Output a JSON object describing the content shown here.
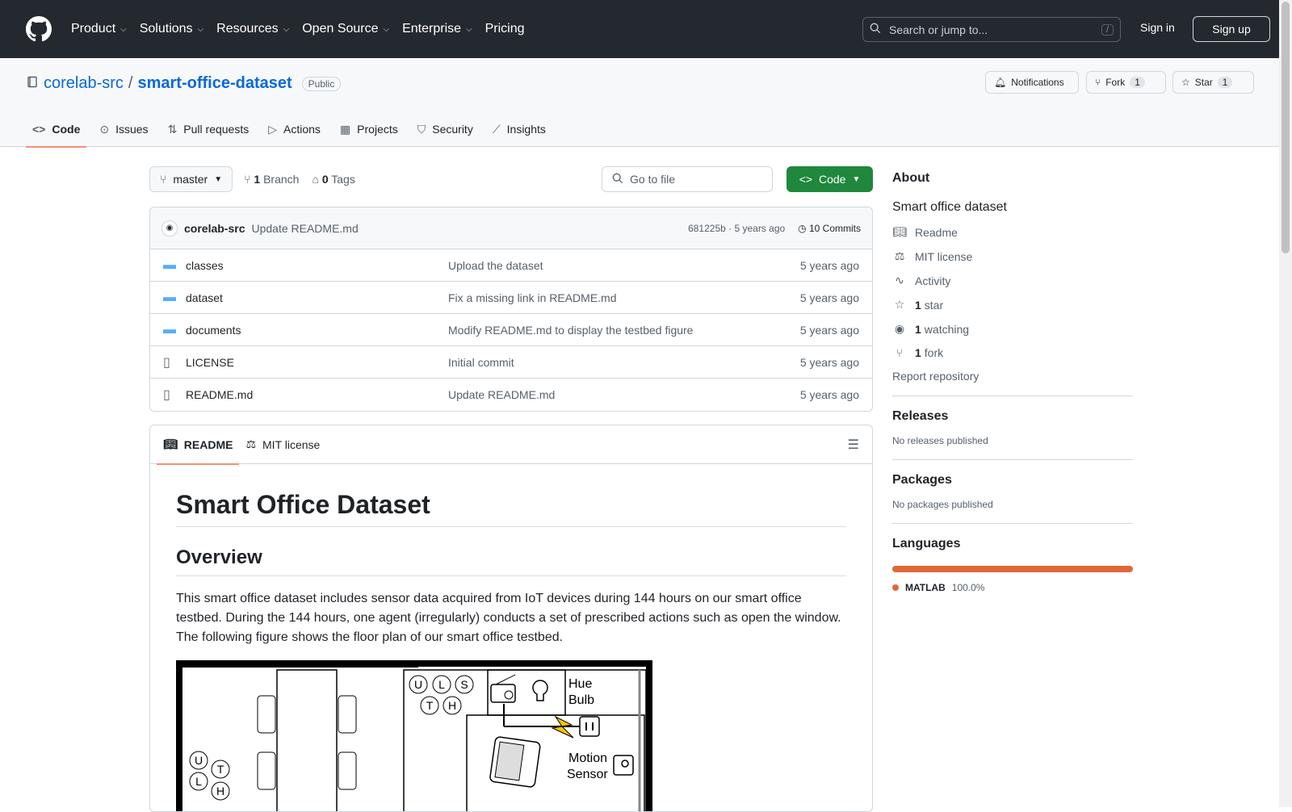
{
  "topnav": {
    "items": [
      "Product",
      "Solutions",
      "Resources",
      "Open Source",
      "Enterprise",
      "Pricing"
    ],
    "search_placeholder": "Search or jump to...",
    "search_key": "/",
    "signin": "Sign in",
    "signup": "Sign up"
  },
  "repo": {
    "owner": "corelab-src",
    "sep": "/",
    "name": "smart-office-dataset",
    "visibility": "Public",
    "notifications": "Notifications",
    "fork": "Fork",
    "fork_count": "1",
    "star": "Star",
    "star_count": "1"
  },
  "tabs": [
    "Code",
    "Issues",
    "Pull requests",
    "Actions",
    "Projects",
    "Security",
    "Insights"
  ],
  "filebar": {
    "branch": "master",
    "branches_num": "1",
    "branches_label": "Branch",
    "tags_num": "0",
    "tags_label": "Tags",
    "goto_placeholder": "Go to file",
    "code_btn": "Code"
  },
  "commit": {
    "author": "corelab-src",
    "message": "Update README.md",
    "hash_age": "681225b · 5 years ago",
    "commits": "10 Commits"
  },
  "files": [
    {
      "name": "classes",
      "type": "dir",
      "msg": "Upload the dataset",
      "age": "5 years ago"
    },
    {
      "name": "dataset",
      "type": "dir",
      "msg": "Fix a missing link in README.md",
      "age": "5 years ago"
    },
    {
      "name": "documents",
      "type": "dir",
      "msg": "Modify README.md to display the testbed figure",
      "age": "5 years ago"
    },
    {
      "name": "LICENSE",
      "type": "file",
      "msg": "Initial commit",
      "age": "5 years ago"
    },
    {
      "name": "README.md",
      "type": "file",
      "msg": "Update README.md",
      "age": "5 years ago"
    }
  ],
  "readme": {
    "tab_readme": "README",
    "tab_license": "MIT license",
    "h1": "Smart Office Dataset",
    "h2": "Overview",
    "p": "This smart office dataset includes sensor data acquired from IoT devices during 144 hours on our smart office testbed. During the 144 hours, one agent (irregularly) conducts a set of prescribed actions such as open the window. The following figure shows the floor plan of our smart office testbed.",
    "figure": {
      "sensors_top": [
        "U",
        "L",
        "S",
        "T",
        "H"
      ],
      "sensors_left": [
        "U",
        "T",
        "L",
        "H"
      ],
      "hue": "Hue",
      "bulb": "Bulb",
      "motion": "Motion",
      "sensor": "Sensor"
    }
  },
  "about": {
    "title": "About",
    "desc": "Smart office dataset",
    "readme": "Readme",
    "license": "MIT license",
    "activity": "Activity",
    "stars_num": "1",
    "stars_label": "star",
    "watch_num": "1",
    "watch_label": "watching",
    "fork_num": "1",
    "fork_label": "fork",
    "report": "Report repository"
  },
  "releases": {
    "title": "Releases",
    "text": "No releases published"
  },
  "packages": {
    "title": "Packages",
    "text": "No packages published"
  },
  "languages": {
    "title": "Languages",
    "name": "MATLAB",
    "pct": "100.0%",
    "color": "#e16737"
  }
}
